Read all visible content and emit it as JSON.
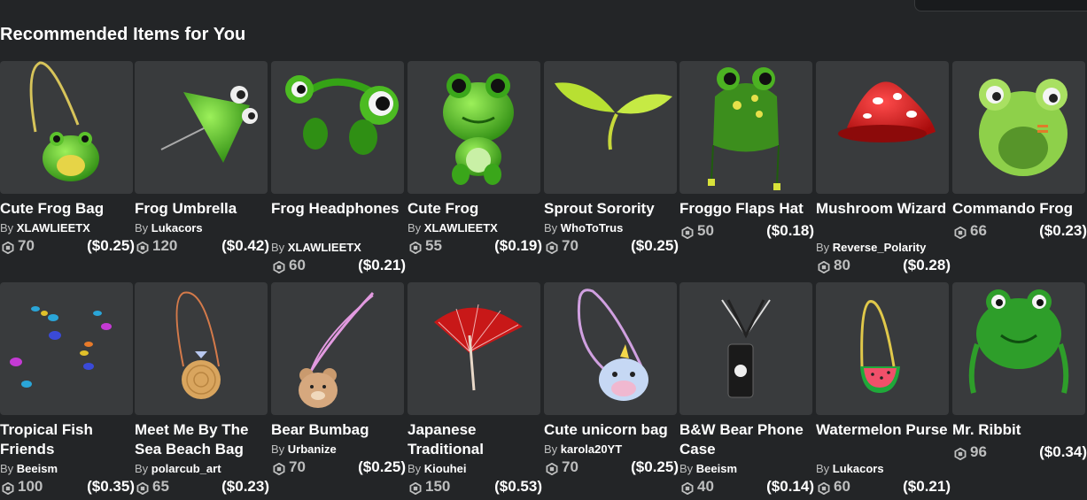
{
  "page": {
    "section_title": "Recommended Items for You"
  },
  "items": [
    {
      "name": "Cute Frog Bag",
      "by": "By",
      "creator": "XLAWLIEETX",
      "robux": "70",
      "usd": "($0.25)",
      "icon": "frog-bag-icon"
    },
    {
      "name": "Frog Umbrella",
      "by": "By",
      "creator": "Lukacors",
      "robux": "120",
      "usd": "($0.42)",
      "icon": "frog-umbrella-icon"
    },
    {
      "name": "Frog Headphones",
      "by": "By",
      "creator": "XLAWLIEETX",
      "robux": "60",
      "usd": "($0.21)",
      "icon": "frog-headphones-icon"
    },
    {
      "name": "Cute Frog",
      "by": "By",
      "creator": "XLAWLIEETX",
      "robux": "55",
      "usd": "($0.19)",
      "icon": "cute-frog-icon"
    },
    {
      "name": "Sprout Sorority",
      "by": "By",
      "creator": "WhoToTrus",
      "robux": "70",
      "usd": "($0.25)",
      "icon": "sprout-icon"
    },
    {
      "name": "Froggo Flaps Hat",
      "by": "",
      "creator": "",
      "robux": "50",
      "usd": "($0.18)",
      "icon": "frog-hat-icon"
    },
    {
      "name": "Mushroom Wizard",
      "by": "By",
      "creator": "Reverse_Polarity",
      "robux": "80",
      "usd": "($0.28)",
      "icon": "mushroom-hat-icon"
    },
    {
      "name": "Commando Frog",
      "by": "",
      "creator": "",
      "robux": "66",
      "usd": "($0.23)",
      "icon": "frog-mask-icon"
    },
    {
      "name": "Tropical Fish Friends",
      "by": "By",
      "creator": "Beeism",
      "robux": "100",
      "usd": "($0.35)",
      "icon": "tropical-fish-icon"
    },
    {
      "name": "Meet Me By The Sea Beach Bag",
      "by": "By",
      "creator": "polarcub_art",
      "robux": "65",
      "usd": "($0.23)",
      "icon": "beach-bag-icon"
    },
    {
      "name": "Bear Bumbag",
      "by": "By",
      "creator": "Urbanize",
      "robux": "70",
      "usd": "($0.25)",
      "icon": "bear-bag-icon"
    },
    {
      "name": "Japanese Traditional",
      "by": "By",
      "creator": "Kiouhei",
      "robux": "150",
      "usd": "($0.53)",
      "icon": "parasol-icon"
    },
    {
      "name": "Cute unicorn bag",
      "by": "By",
      "creator": "karola20YT",
      "robux": "70",
      "usd": "($0.25)",
      "icon": "unicorn-bag-icon"
    },
    {
      "name": "B&W Bear Phone Case",
      "by": "By",
      "creator": "Beeism",
      "robux": "40",
      "usd": "($0.14)",
      "icon": "phone-case-icon"
    },
    {
      "name": "Watermelon Purse",
      "by": "By",
      "creator": "Lukacors",
      "robux": "60",
      "usd": "($0.21)",
      "icon": "watermelon-purse-icon"
    },
    {
      "name": "Mr. Ribbit",
      "by": "",
      "creator": "",
      "robux": "96",
      "usd": "($0.34)",
      "icon": "frog-hat-knit-icon"
    }
  ]
}
